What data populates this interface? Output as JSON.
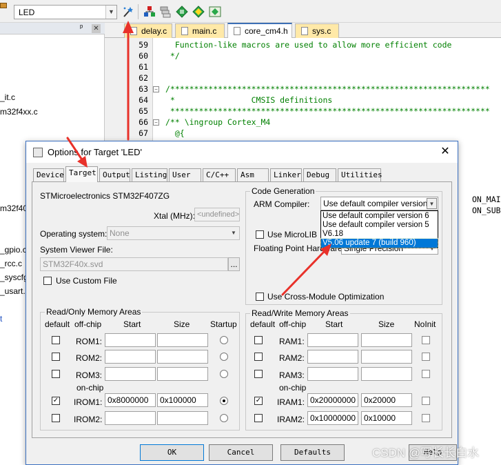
{
  "toolbar": {
    "target_value": "LED"
  },
  "project_tree": {
    "items": [
      "_it.c",
      "m32f4xx.c",
      "m32f40_",
      "_gpio.c",
      "_rcc.c",
      "_syscfg.",
      "_usart.c",
      "t"
    ]
  },
  "editor": {
    "tabs": [
      "delay.c",
      "main.c",
      "core_cm4.h",
      "sys.c"
    ],
    "active_tab": "core_cm4.h",
    "lines": [
      {
        "n": "59",
        "text": "  Function-like macros are used to allow more efficient code"
      },
      {
        "n": "60",
        "text": " */"
      },
      {
        "n": "61",
        "text": ""
      },
      {
        "n": "62",
        "text": ""
      },
      {
        "n": "63",
        "text": "/*******************************************************************"
      },
      {
        "n": "64",
        "text": " *                CMSIS definitions"
      },
      {
        "n": "65",
        "text": " *******************************************************************"
      },
      {
        "n": "66",
        "text": "/** \\ingroup Cortex_M4"
      },
      {
        "n": "67",
        "text": "  @{"
      }
    ],
    "right_fragments": [
      "ON_MAIN <",
      "ON_SUB"
    ]
  },
  "dialog": {
    "title": "Options for Target 'LED'",
    "close_glyph": "✕",
    "tabs": [
      "Device",
      "Target",
      "Output",
      "Listing",
      "User",
      "C/C++",
      "Asm",
      "Linker",
      "Debug",
      "Utilities"
    ],
    "active_tab": "Target",
    "device_name": "STMicroelectronics STM32F407ZG",
    "xtal_label": "Xtal (MHz):",
    "xtal_value": "<undefined>",
    "os_label": "Operating system:",
    "os_value": "None",
    "svd_label": "System Viewer File:",
    "svd_value": "STM32F40x.svd",
    "browse_label": "...",
    "custom_file_label": "Use Custom File",
    "code_gen_title": "Code Generation",
    "compiler_label": "ARM Compiler:",
    "compiler_value": "Use default compiler version 5",
    "compiler_options": [
      "Use default compiler version 6",
      "Use default compiler version 5",
      "V6.18",
      "V5.06 update 7 (build 960)"
    ],
    "compiler_selected_index": 3,
    "microlib_label": "Use MicroLIB",
    "fp_label": "Floating Point Hardware:",
    "fp_value": "Single Precision",
    "cross_module_label": "Use Cross-Module Optimization",
    "ro_title": "Read/Only Memory Areas",
    "rw_title": "Read/Write Memory Areas",
    "ro_headers": {
      "default": "default",
      "offchip": "off-chip",
      "start": "Start",
      "size": "Size",
      "startup": "Startup"
    },
    "rw_headers": {
      "default": "default",
      "offchip": "off-chip",
      "start": "Start",
      "size": "Size",
      "noinit": "NoInit"
    },
    "onchip_label": "on-chip",
    "ro_rows": [
      {
        "name": "ROM1:",
        "start": "",
        "size": "",
        "checked": false,
        "startup": false
      },
      {
        "name": "ROM2:",
        "start": "",
        "size": "",
        "checked": false,
        "startup": false
      },
      {
        "name": "ROM3:",
        "start": "",
        "size": "",
        "checked": false,
        "startup": false
      },
      {
        "name": "IROM1:",
        "start": "0x8000000",
        "size": "0x100000",
        "checked": true,
        "startup": true
      },
      {
        "name": "IROM2:",
        "start": "",
        "size": "",
        "checked": false,
        "startup": false
      }
    ],
    "rw_rows": [
      {
        "name": "RAM1:",
        "start": "",
        "size": "",
        "checked": false
      },
      {
        "name": "RAM2:",
        "start": "",
        "size": "",
        "checked": false
      },
      {
        "name": "RAM3:",
        "start": "",
        "size": "",
        "checked": false
      },
      {
        "name": "IRAM1:",
        "start": "0x20000000",
        "size": "0x20000",
        "checked": true
      },
      {
        "name": "IRAM2:",
        "start": "0x10000000",
        "size": "0x10000",
        "checked": false
      }
    ],
    "buttons": {
      "ok": "OK",
      "cancel": "Cancel",
      "defaults": "Defaults",
      "help": "Help"
    }
  },
  "watermark": "CSDN @写长长白水",
  "colors": {
    "accent": "#0078d7",
    "annotation": "#e8312a",
    "tab_bg": "#ffe9a8"
  }
}
